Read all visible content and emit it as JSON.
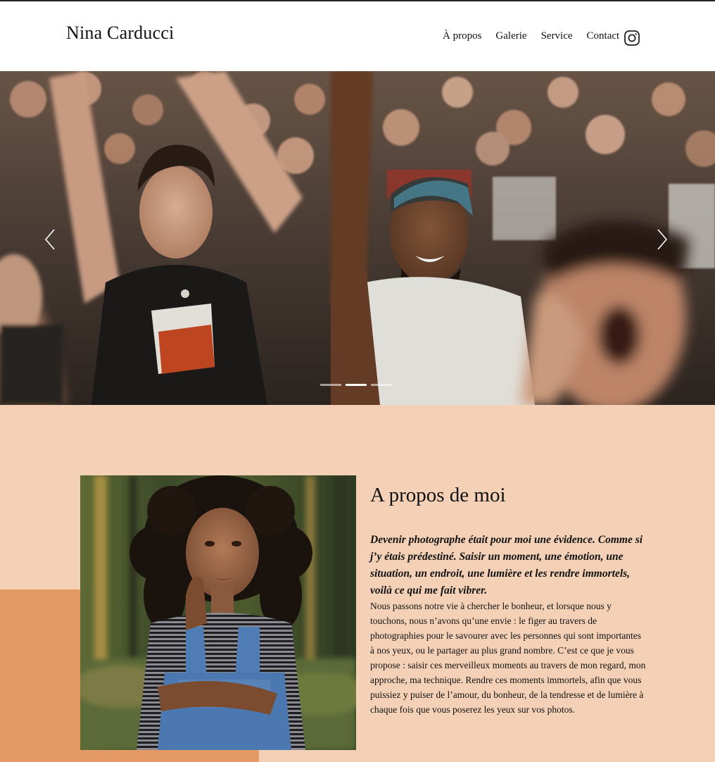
{
  "header": {
    "brand": "Nina Carducci",
    "nav": [
      "À propos",
      "Galerie",
      "Service",
      "Contact"
    ],
    "instagram_icon": "instagram-icon"
  },
  "carousel": {
    "slides": 3,
    "active_slide": 2,
    "prev_icon": "chevron-left-icon",
    "next_icon": "chevron-right-icon",
    "image": "concert-crowd-photo"
  },
  "about": {
    "title": "A propos de moi",
    "lead": "Devenir photographe était pour moi une évidence. Comme si j’y étais prédestiné. Saisir un moment, une émotion, une situation, un endroit, une lumière et les rendre immortels, voilà ce qui me fait vibrer.",
    "body": "Nous passons notre vie à chercher le bonheur, et lorsque nous y touchons, nous n’avons qu’une envie : le figer au travers de photographies pour le savourer avec les personnes qui sont importantes à nos yeux, ou le partager au plus grand nombre. C’est ce que je vous propose : saisir ces merveilleux moments au travers de mon regard, mon approche, ma technique. Rendre ces moments immortels, afin que vous puissiez y puiser de l’amour, du bonheur, de la tendresse et de lumière à chaque fois que vous poserez les yeux sur vos photos.",
    "portrait": "portrait-photo"
  },
  "colors": {
    "section_bg": "#f4d1b6",
    "accent": "#e59a65"
  }
}
